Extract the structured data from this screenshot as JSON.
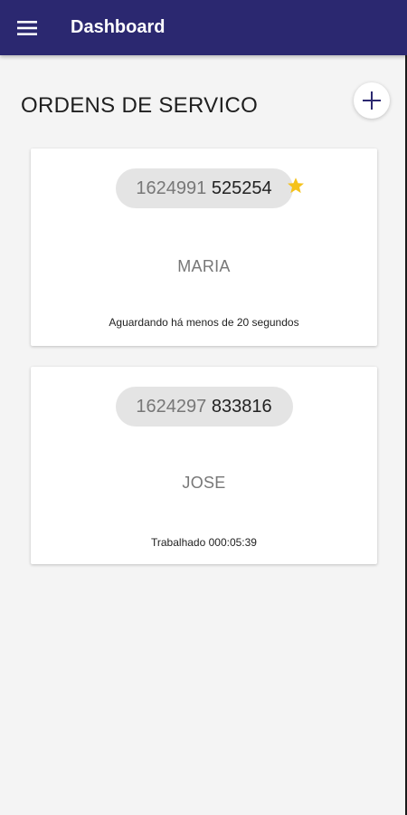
{
  "appbar": {
    "title": "Dashboard",
    "menu_icon": "hamburger-menu-icon",
    "background_color": "#2b2870"
  },
  "section": {
    "title": "ORDENS DE SERVICO",
    "add_icon": "plus-icon"
  },
  "orders": [
    {
      "number_prefix": "1624991",
      "number_suffix": "525254",
      "client": "MARIA",
      "status": "Aguardando há menos de 20 segundos",
      "starred": true,
      "star_color": "#f5c21b"
    },
    {
      "number_prefix": "1624297",
      "number_suffix": "833816",
      "client": "JOSE",
      "status": "Trabalhado 000:05:39",
      "starred": false
    }
  ]
}
